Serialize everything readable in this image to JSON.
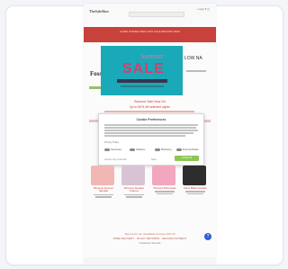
{
  "header": {
    "logo_text": "TheSaleShoe",
    "search_placeholder": "",
    "top_links": "Login  ♥  🛒"
  },
  "nav": {
    "text": "HOME  WOMEN  MEN  KIDS  SALE  BRANDS  NEW"
  },
  "hero": {
    "script": "Summer",
    "title": "SALE",
    "left_brand": "Fossil",
    "right_text": "LOW  NA"
  },
  "promo": {
    "line1": "Summer Sale Now On",
    "line2": "Up to 50% off selected styles"
  },
  "cookie_banner": {
    "title": "Cookie Preferences",
    "link": "Privacy Policy",
    "options": [
      "Necessary",
      "Statistics",
      "Marketing",
      "External Media"
    ],
    "secondary_button": "Accept only essential",
    "mid_button": "Save",
    "primary_button": "Accept all",
    "primary_color": "#8cc752"
  },
  "products": [
    {
      "title": "Womens Summer Sandals",
      "img_color": "#f0b7b5"
    },
    {
      "title": "Womens Sneaker Trainers",
      "img_color": "#d8c3d4"
    },
    {
      "title": "Womens Pink Heels",
      "img_color": "#f2a7bf"
    },
    {
      "title": "Mens Black Sandals",
      "img_color": "#2d2d2d"
    }
  ],
  "lower": {
    "line1": "Sign up for our newsletter and get 10% off",
    "line2": "FREE DELIVERY  ·  30 DAY RETURNS  ·  SECURE PAYMENT",
    "line3": "Customer Service"
  },
  "help_button": "?"
}
